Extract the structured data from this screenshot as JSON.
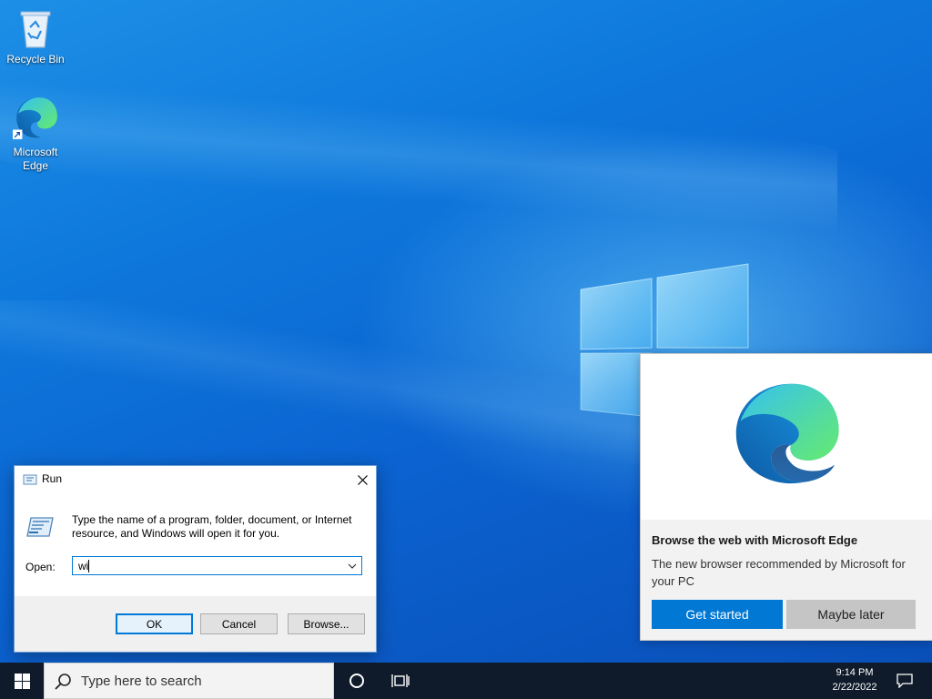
{
  "desktop": {
    "icons": [
      {
        "label": "Recycle Bin",
        "icon": "recycle-bin-icon"
      },
      {
        "label_line1": "Microsoft",
        "label_line2": "Edge",
        "icon": "edge-icon"
      }
    ]
  },
  "run_dialog": {
    "title": "Run",
    "description": "Type the name of a program, folder, document, or Internet resource, and Windows will open it for you.",
    "open_label": "Open:",
    "open_value": "wi",
    "ok_label": "OK",
    "cancel_label": "Cancel",
    "browse_label": "Browse...",
    "accent": "#0078d7"
  },
  "edge_promo": {
    "heading": "Browse the web with Microsoft Edge",
    "body": "The new browser recommended by Microsoft for your PC",
    "primary_label": "Get started",
    "secondary_label": "Maybe later",
    "accent": "#0078d4"
  },
  "taskbar": {
    "search_placeholder": "Type here to search",
    "time": "9:14 PM",
    "date": "2/22/2022"
  }
}
